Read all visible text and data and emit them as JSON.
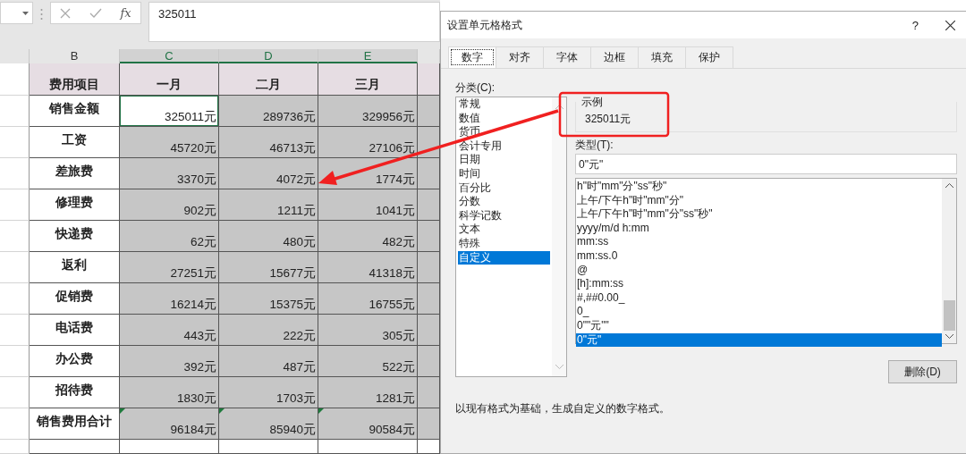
{
  "formula_bar": {
    "function_label": "fx",
    "formula": "325011"
  },
  "sheet": {
    "columns": [
      {
        "label": "B",
        "selected": false
      },
      {
        "label": "C",
        "selected": true
      },
      {
        "label": "D",
        "selected": true
      },
      {
        "label": "E",
        "selected": true
      }
    ],
    "header_row": {
      "label": "费用项目",
      "cells": [
        "一月",
        "二月",
        "三月"
      ]
    },
    "rows": [
      {
        "label": "销售金额",
        "flagged": false,
        "cells": [
          {
            "text": "325011元",
            "selected": false
          },
          {
            "text": "289736元",
            "selected": true
          },
          {
            "text": "329956元",
            "selected": true
          }
        ]
      },
      {
        "label": "工资",
        "flagged": false,
        "cells": [
          {
            "text": "45720元",
            "selected": true
          },
          {
            "text": "46713元",
            "selected": true
          },
          {
            "text": "27106元",
            "selected": true
          }
        ]
      },
      {
        "label": "差旅费",
        "flagged": false,
        "cells": [
          {
            "text": "3370元",
            "selected": true
          },
          {
            "text": "4072元",
            "selected": true
          },
          {
            "text": "1774元",
            "selected": true
          }
        ]
      },
      {
        "label": "修理费",
        "flagged": false,
        "cells": [
          {
            "text": "902元",
            "selected": true
          },
          {
            "text": "1211元",
            "selected": true
          },
          {
            "text": "1041元",
            "selected": true
          }
        ]
      },
      {
        "label": "快递费",
        "flagged": false,
        "cells": [
          {
            "text": "62元",
            "selected": true
          },
          {
            "text": "480元",
            "selected": true
          },
          {
            "text": "482元",
            "selected": true
          }
        ]
      },
      {
        "label": "返利",
        "flagged": false,
        "cells": [
          {
            "text": "27251元",
            "selected": true
          },
          {
            "text": "15677元",
            "selected": true
          },
          {
            "text": "41318元",
            "selected": true
          }
        ]
      },
      {
        "label": "促销费",
        "flagged": false,
        "cells": [
          {
            "text": "16214元",
            "selected": true
          },
          {
            "text": "15375元",
            "selected": true
          },
          {
            "text": "16755元",
            "selected": true
          }
        ]
      },
      {
        "label": "电话费",
        "flagged": false,
        "cells": [
          {
            "text": "443元",
            "selected": true
          },
          {
            "text": "222元",
            "selected": true
          },
          {
            "text": "305元",
            "selected": true
          }
        ]
      },
      {
        "label": "办公费",
        "flagged": false,
        "cells": [
          {
            "text": "392元",
            "selected": true
          },
          {
            "text": "487元",
            "selected": true
          },
          {
            "text": "522元",
            "selected": true
          }
        ]
      },
      {
        "label": "招待费",
        "flagged": false,
        "cells": [
          {
            "text": "1830元",
            "selected": true
          },
          {
            "text": "1703元",
            "selected": true
          },
          {
            "text": "1281元",
            "selected": true
          }
        ]
      },
      {
        "label": "销售费用合计",
        "flagged": true,
        "cells": [
          {
            "text": "96184元",
            "selected": true
          },
          {
            "text": "85940元",
            "selected": true
          },
          {
            "text": "90584元",
            "selected": true
          }
        ]
      }
    ]
  },
  "dialog": {
    "title": "设置单元格格式",
    "help": "?",
    "tabs": [
      {
        "label": "数字",
        "selected": true
      },
      {
        "label": "对齐",
        "selected": false
      },
      {
        "label": "字体",
        "selected": false
      },
      {
        "label": "边框",
        "selected": false
      },
      {
        "label": "填充",
        "selected": false
      },
      {
        "label": "保护",
        "selected": false
      }
    ],
    "category_label": "分类(C):",
    "categories": [
      {
        "label": "常规",
        "selected": false
      },
      {
        "label": "数值",
        "selected": false
      },
      {
        "label": "货币",
        "selected": false
      },
      {
        "label": "会计专用",
        "selected": false
      },
      {
        "label": "日期",
        "selected": false
      },
      {
        "label": "时间",
        "selected": false
      },
      {
        "label": "百分比",
        "selected": false
      },
      {
        "label": "分数",
        "selected": false
      },
      {
        "label": "科学记数",
        "selected": false
      },
      {
        "label": "文本",
        "selected": false
      },
      {
        "label": "特殊",
        "selected": false
      },
      {
        "label": "自定义",
        "selected": true
      }
    ],
    "sample": {
      "label": "示例",
      "value": "325011元"
    },
    "type_label": "类型(T):",
    "type_value": "0\"元\"",
    "formats": [
      {
        "label": "h\"时\"mm\"分\"ss\"秒\"",
        "selected": false
      },
      {
        "label": "上午/下午h\"时\"mm\"分\"",
        "selected": false
      },
      {
        "label": "上午/下午h\"时\"mm\"分\"ss\"秒\"",
        "selected": false
      },
      {
        "label": "yyyy/m/d h:mm",
        "selected": false
      },
      {
        "label": "mm:ss",
        "selected": false
      },
      {
        "label": "mm:ss.0",
        "selected": false
      },
      {
        "label": "@",
        "selected": false
      },
      {
        "label": "[h]:mm:ss",
        "selected": false
      },
      {
        "label": "#,##0.00_",
        "selected": false
      },
      {
        "label": "0_",
        "selected": false
      },
      {
        "label": "0\"\"元\"\"",
        "selected": false
      },
      {
        "label": "0\"元\"",
        "selected": true
      }
    ],
    "delete_button": "删除(D)",
    "description": "以现有格式为基础，生成自定义的数字格式。"
  }
}
